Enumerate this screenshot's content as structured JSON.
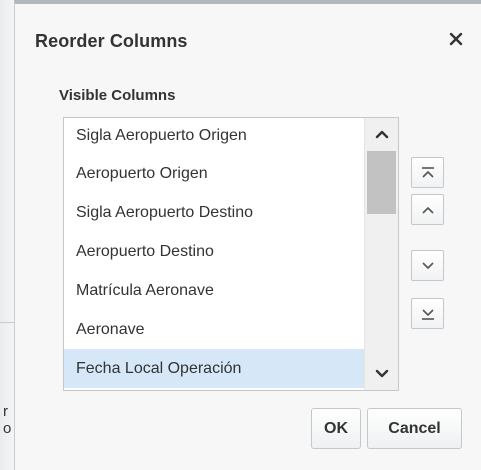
{
  "background": {
    "fragment_1": "r",
    "fragment_2": "o"
  },
  "dialog": {
    "title": "Reorder Columns",
    "close_icon": "close-icon",
    "section_label": "Visible Columns",
    "columns": [
      "Sigla Aeropuerto Origen",
      "Aeropuerto Origen",
      "Sigla Aeropuerto Destino",
      "Aeropuerto Destino",
      "Matrícula Aeronave",
      "Aeronave",
      "Fecha Local Operación"
    ],
    "selected_column": "Fecha Local Operación",
    "reorder_buttons": {
      "move_top_icon": "move-to-top-icon",
      "move_up_icon": "move-up-icon",
      "move_down_icon": "move-down-icon",
      "move_bottom_icon": "move-to-bottom-icon"
    },
    "ok_label": "OK",
    "cancel_label": "Cancel"
  },
  "colors": {
    "selected_row": "#d6e7f7",
    "dialog_bg": "#f7f7f7",
    "border": "#c4c8cc",
    "scroll_thumb": "#c2c2c2"
  }
}
